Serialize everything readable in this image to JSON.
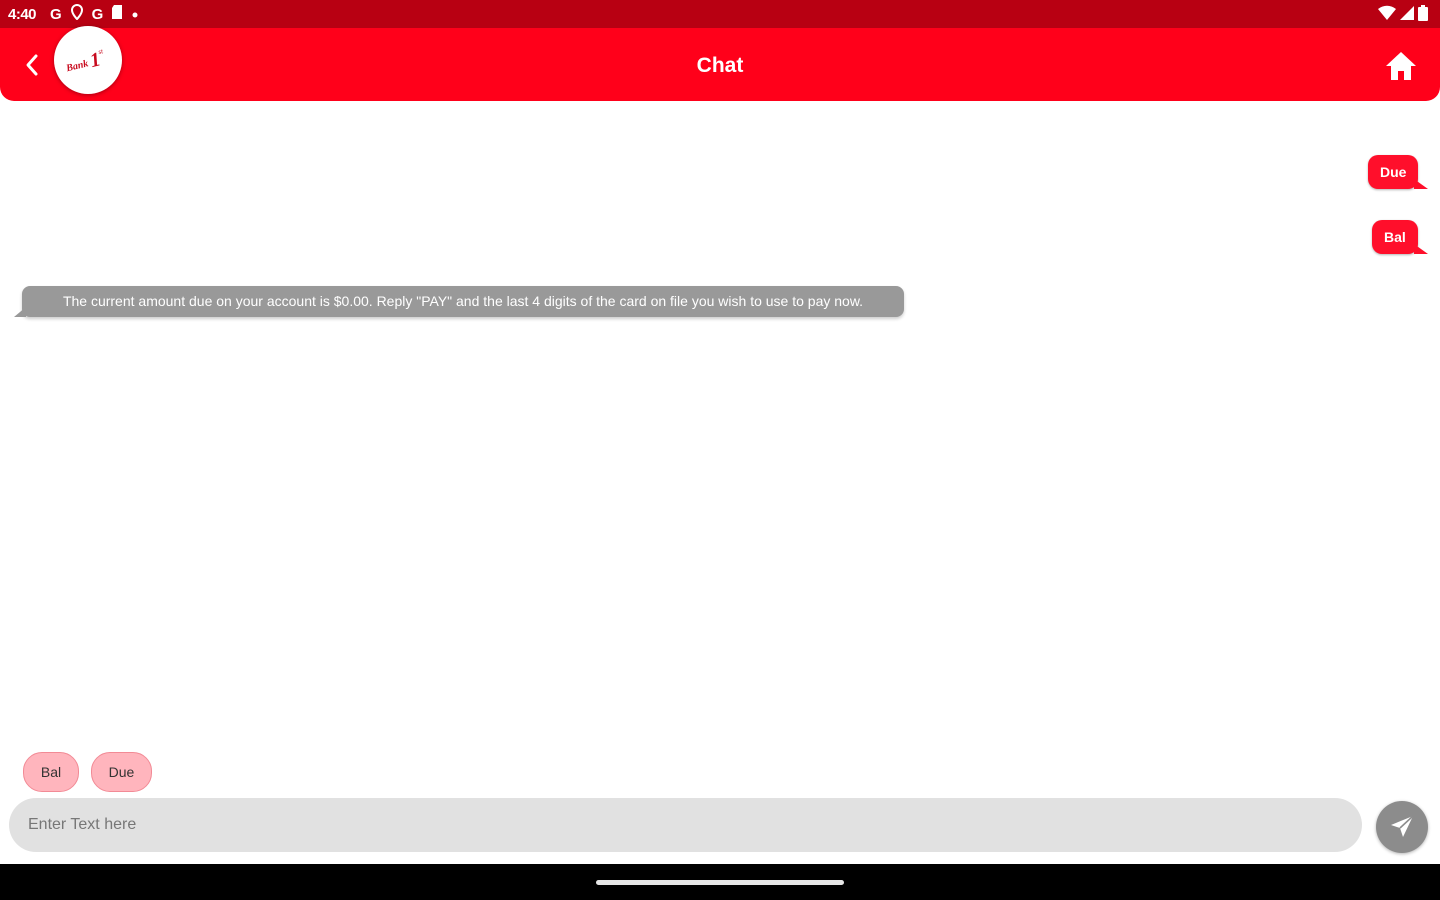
{
  "status_bar": {
    "time": "4:40",
    "left_icons": [
      "google-icon",
      "location-icon",
      "google-icon",
      "sd-card-icon",
      "dot-icon"
    ],
    "right_icons": [
      "wifi-icon",
      "signal-icon",
      "battery-icon"
    ]
  },
  "app_bar": {
    "title": "Chat",
    "logo_text": "Bank 1st",
    "colors": {
      "primary": "#ff001a",
      "status": "#b80012"
    }
  },
  "messages": {
    "outgoing": [
      {
        "text": "Due"
      },
      {
        "text": "Bal"
      }
    ],
    "incoming": [
      {
        "text": "The current amount due on your account is $0.00. Reply \"PAY\" and the last 4 digits of the card on file you wish to use to pay now."
      }
    ]
  },
  "quick_replies": [
    {
      "label": "Bal"
    },
    {
      "label": "Due"
    }
  ],
  "composer": {
    "placeholder": "Enter Text here",
    "value": ""
  }
}
